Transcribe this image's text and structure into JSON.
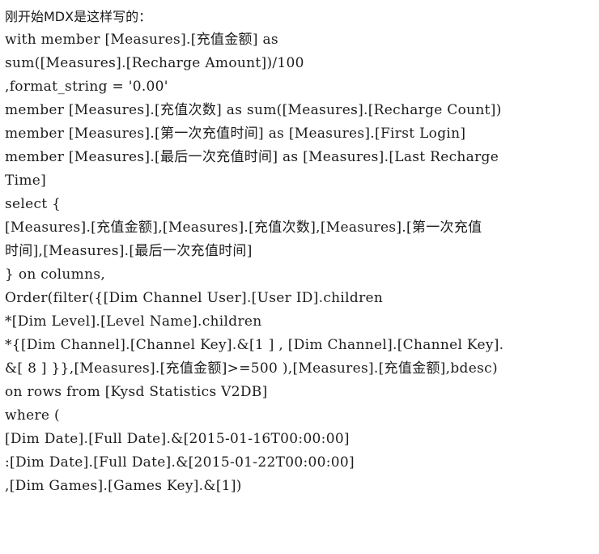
{
  "document": {
    "background_color": "#ffffff",
    "text_color": "#1c1c1c",
    "intro": "刚开始MDX是这样写的：",
    "code_lines": [
      "with member [Measures].[充值金额] as",
      "sum([Measures].[Recharge Amount])/100",
      ",format_string = '0.00'",
      "member [Measures].[充值次数] as sum([Measures].[Recharge Count])",
      "member [Measures].[第一次充值时间] as [Measures].[First Login]",
      "member [Measures].[最后一次充值时间] as [Measures].[Last Recharge",
      "Time]",
      "select {",
      "[Measures].[充值金额],[Measures].[充值次数],[Measures].[第一次充值",
      "时间],[Measures].[最后一次充值时间]",
      "} on columns,",
      "Order(filter({[Dim Channel User].[User ID].children",
      "*[Dim Level].[Level Name].children",
      "*{[Dim Channel].[Channel Key].&[1 ] , [Dim Channel].[Channel Key].",
      "&[ 8 ] }},[Measures].[充值金额]>=500 ),[Measures].[充值金额],bdesc)",
      "on rows from [Kysd Statistics V2DB]",
      "where (",
      "[Dim Date].[Full Date].&[2015-01-16T00:00:00]",
      ":[Dim Date].[Full Date].&[2015-01-22T00:00:00]",
      ",[Dim Games].[Games Key].&[1])"
    ]
  }
}
